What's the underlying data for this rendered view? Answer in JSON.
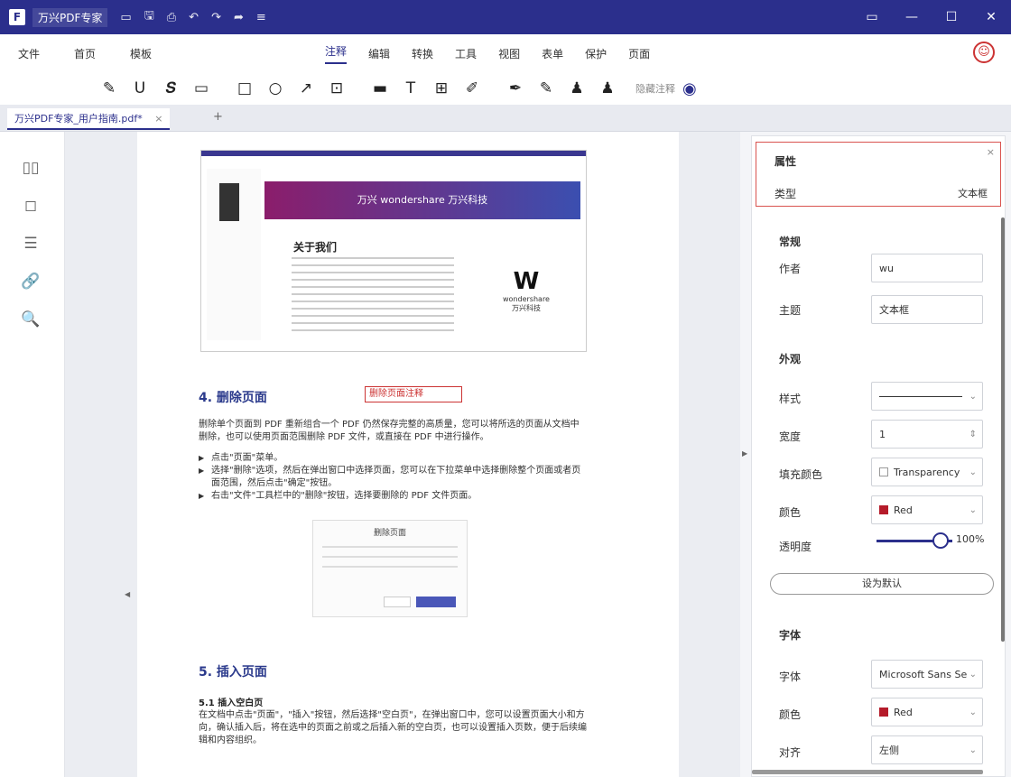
{
  "titlebar": {
    "logo": "F",
    "title": "万兴PDF专家",
    "icons": [
      "folder-icon",
      "save-icon",
      "print-icon",
      "undo-icon",
      "redo-icon",
      "share-icon",
      "more-icon"
    ],
    "controls": [
      "▭",
      "—",
      "☐",
      "✕"
    ]
  },
  "menu": {
    "left": [
      "文件",
      "首页",
      "模板"
    ],
    "center": [
      "注释",
      "编辑",
      "转换",
      "工具",
      "视图",
      "表单",
      "保护",
      "页面"
    ],
    "active": "注释"
  },
  "toolbar": {
    "tools": [
      "✎",
      "U",
      "𝑺",
      "▭",
      "□",
      "○",
      "↗",
      "⊡",
      "▬",
      "T",
      "⊞",
      "✐",
      "✒",
      "✎",
      "♟",
      "♟"
    ],
    "eye_text": "隐藏注释"
  },
  "tab": {
    "label": "万兴PDF专家_用户指南.pdf*",
    "close": "×",
    "add": "+"
  },
  "leftbar": {
    "icons": [
      "▯▯",
      "◻",
      "☰",
      "🔗",
      "🔍"
    ]
  },
  "document": {
    "shot_banner": "万兴 wondershare 万兴科技",
    "shot_heading": "关于我们",
    "ws_letter": "W",
    "ws_name": "wondershare",
    "ws_sub": "万兴科技",
    "h_delete": "4. 删除页面",
    "note_text": "删除页面注释",
    "para1": "删除单个页面到 PDF 重新组合一个 PDF 仍然保存完整的高质量，您可以将所选的页面从文档中删除，也可以使用页面范围删除 PDF 文件，或直接在 PDF 中进行操作。",
    "bullets": [
      "点击\"页面\"菜单。",
      "选择\"删除\"选项，然后在弹出窗口中选择页面，您可以在下拉菜单中选择删除整个页面或者页面范围，然后点击\"确定\"按钮。",
      "右击\"文件\"工具栏中的\"删除\"按钮，选择要删除的 PDF 文件页面。"
    ],
    "dialog_title": "删除页面",
    "h_insert": "5. 插入页面",
    "subhead": "5.1 插入空白页",
    "para2": "在文档中点击\"页面\"，\"插入\"按钮，然后选择\"空白页\"，在弹出窗口中，您可以设置页面大小和方向，确认插入后，将在选中的页面之前或之后插入新的空白页，也可以设置插入页数，便于后续编辑和内容组织。"
  },
  "panel": {
    "title": "属性",
    "type_label": "类型",
    "type_value": "文本框",
    "close": "×",
    "section_general": "常规",
    "author_label": "作者",
    "author_value": "wu",
    "subject_label": "主题",
    "subject_value": "文本框",
    "section_appearance": "外观",
    "style_label": "样式",
    "width_label": "宽度",
    "width_value": "1",
    "fill_label": "填充颜色",
    "fill_value": "Transparency",
    "color_label": "颜色",
    "color_value": "Red",
    "opacity_label": "透明度",
    "opacity_value": "100%",
    "opacity_fraction": 1.0,
    "set_default": "设为默认",
    "section_font": "字体",
    "font_label": "字体",
    "font_value": "Microsoft Sans Se",
    "font_color_label": "颜色",
    "font_color_value": "Red",
    "align_label": "对齐",
    "align_value": "左侧",
    "red": "#b51b2a"
  }
}
